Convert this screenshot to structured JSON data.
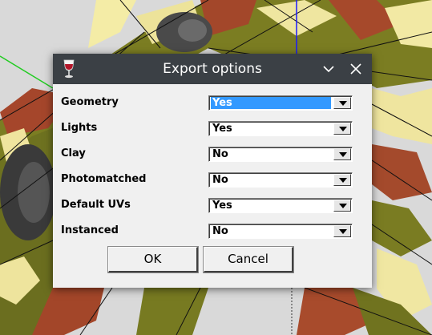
{
  "dialog": {
    "title": "Export options",
    "icon": "wine-glass-icon",
    "controls": [
      "chevron-down-icon",
      "close-icon"
    ],
    "options": [
      {
        "label": "Geometry",
        "value": "Yes",
        "focused": true
      },
      {
        "label": "Lights",
        "value": "Yes",
        "focused": false
      },
      {
        "label": "Clay",
        "value": "No",
        "focused": false
      },
      {
        "label": "Photomatched",
        "value": "No",
        "focused": false
      },
      {
        "label": "Default UVs",
        "value": "Yes",
        "focused": false
      },
      {
        "label": "Instanced",
        "value": "No",
        "focused": false
      }
    ],
    "ok_label": "OK",
    "cancel_label": "Cancel"
  },
  "colors": {
    "titlebar": "#3b4045",
    "selection": "#3399ff",
    "dialog_bg": "#f0f0f0"
  }
}
